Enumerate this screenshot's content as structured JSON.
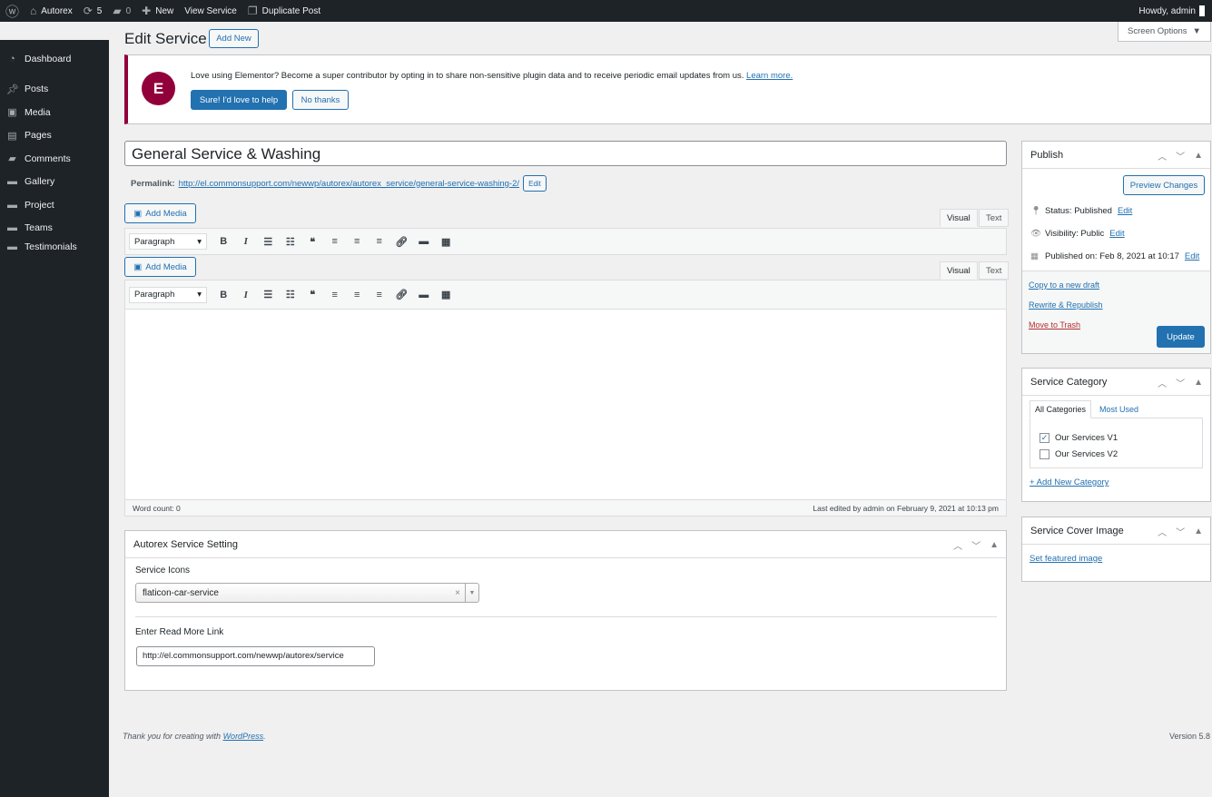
{
  "adminbar": {
    "site": "Autorex",
    "updates": "5",
    "comments": "0",
    "new": "New",
    "view": "View Service",
    "duplicate": "Duplicate Post",
    "howdy": "Howdy, admin"
  },
  "sidebar": {
    "items": [
      "Dashboard",
      "Posts",
      "Media",
      "Pages",
      "Comments",
      "Gallery",
      "Project",
      "Teams",
      "Testimonials"
    ]
  },
  "screen_options": "Screen Options",
  "page": {
    "title": "Edit Service",
    "add_new": "Add New"
  },
  "notice": {
    "text": "Love using Elementor? Become a super contributor by opting in to share non-sensitive plugin data and to receive periodic email updates from us.",
    "learn": "Learn more.",
    "yes": "Sure! I'd love to help",
    "no": "No thanks",
    "brand_color": "#92003b"
  },
  "post": {
    "title": "General Service & Washing",
    "permalink_label": "Permalink:",
    "permalink": "http://el.commonsupport.com/newwp/autorex/autorex_service/general-service-washing-2/",
    "edit": "Edit"
  },
  "editor": {
    "add_media": "Add Media",
    "visual": "Visual",
    "text": "Text",
    "format": "Paragraph",
    "word_count": "Word count: 0",
    "last_edited": "Last edited by admin on February 9, 2021 at 10:13 pm"
  },
  "settings": {
    "title": "Autorex Service Setting",
    "icons_label": "Service Icons",
    "icons_value": "flaticon-car-service",
    "link_label": "Enter Read More Link",
    "link_value": "http://el.commonsupport.com/newwp/autorex/service"
  },
  "publish": {
    "title": "Publish",
    "preview": "Preview Changes",
    "status": "Status: Published",
    "visibility": "Visibility: Public",
    "published_on": "Published on: Feb 8, 2021 at 10:17",
    "edit": "Edit",
    "copy": "Copy to a new draft",
    "rewrite": "Rewrite & Republish",
    "trash": "Move to Trash",
    "update": "Update"
  },
  "category": {
    "title": "Service Category",
    "tab_all": "All Categories",
    "tab_used": "Most Used",
    "items": [
      {
        "label": "Our Services V1",
        "checked": true
      },
      {
        "label": "Our Services V2",
        "checked": false
      }
    ],
    "add": "+ Add New Category"
  },
  "cover": {
    "title": "Service Cover Image",
    "set": "Set featured image"
  },
  "footer": {
    "thanks": "Thank you for creating with ",
    "wp": "WordPress",
    "period": ".",
    "version": "Version 5.8"
  }
}
